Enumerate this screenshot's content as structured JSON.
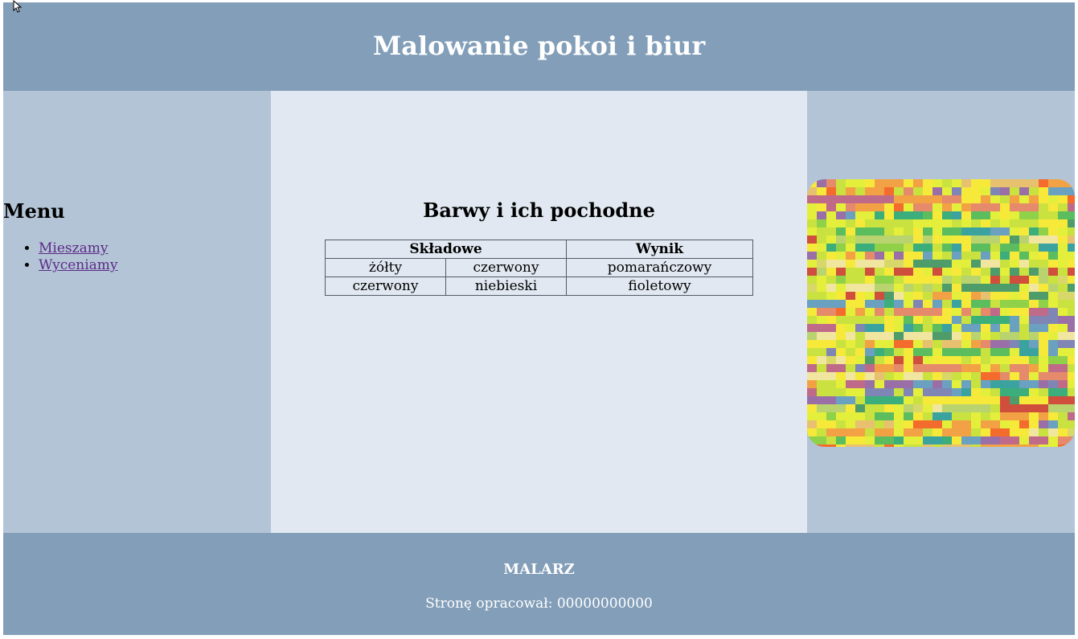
{
  "header": {
    "title": "Malowanie pokoi i biur"
  },
  "menu": {
    "heading": "Menu",
    "links": [
      "Mieszamy",
      "Wyceniamy"
    ]
  },
  "main": {
    "heading": "Barwy i ich pochodne",
    "table": {
      "headers": [
        "Składowe",
        "Wynik"
      ],
      "rows": [
        [
          "żółty",
          "czerwony",
          "pomarańczowy"
        ],
        [
          "czerwony",
          "niebieski",
          "fioletowy"
        ]
      ]
    }
  },
  "footer": {
    "brand": "MALARZ",
    "author": "Stronę opracował: 00000000000"
  },
  "colors": {
    "header_bg": "#829eb8",
    "side_bg": "#b3c4d6",
    "main_bg": "#e1e8f1",
    "link": "#5b2b86"
  },
  "image": {
    "icon": "paint-swatches-image"
  }
}
